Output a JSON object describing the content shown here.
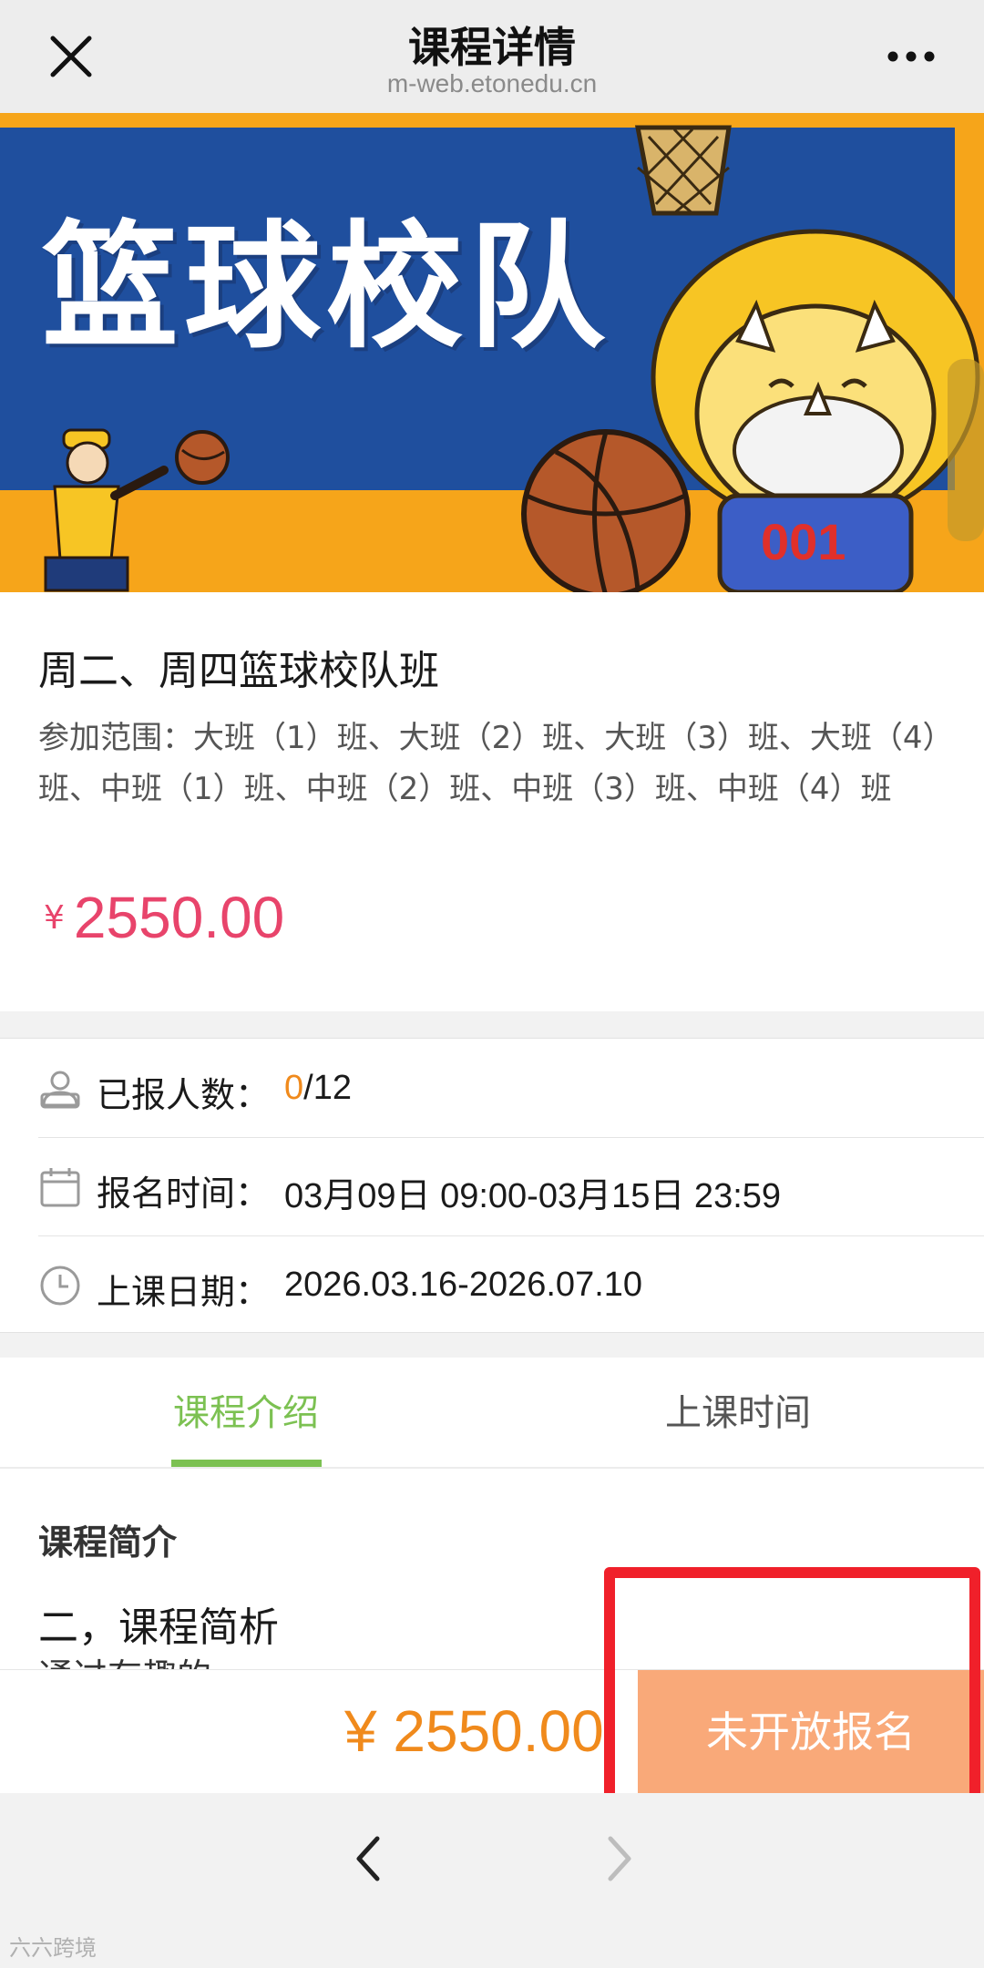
{
  "header": {
    "title": "课程详情",
    "domain": "m-web.etonedu.cn"
  },
  "banner": {
    "title": "篮球校队",
    "jersey_number": "001"
  },
  "course": {
    "name": "周二、周四篮球校队班",
    "scope": "参加范围：大班（1）班、大班（2）班、大班（3）班、大班（4）班、中班（1）班、中班（2）班、中班（3）班、中班（4）班",
    "currency": "¥",
    "price": "2550.00"
  },
  "stats": {
    "enrolled_label": "已报人数：",
    "enrolled_count": "0",
    "enrolled_capacity": "/12",
    "signup_time_label": "报名时间：",
    "signup_time_value": "03月09日 09:00-03月15日 23:59",
    "class_date_label": "上课日期：",
    "class_date_value": "2026.03.16-2026.07.10"
  },
  "tabs": [
    {
      "label": "课程介绍",
      "active": true
    },
    {
      "label": "上课时间",
      "active": false
    }
  ],
  "content": {
    "intro_title": "课程简介",
    "section_title": "二，课程简析",
    "section_text": "通过有趣的…"
  },
  "action_bar": {
    "price": "¥ 2550.00",
    "signup_label": "未开放报名"
  },
  "watermark": "六六跨境",
  "colors": {
    "accent_green": "#7cc152",
    "price_pink": "#e8446b",
    "price_orange": "#f08a1c",
    "signup_button": "#f9a979",
    "highlight_red": "#f0202a",
    "banner_blue": "#1f4f9e",
    "banner_gold": "#f6a51a"
  },
  "icons": {
    "close": "close-icon",
    "more": "more-icon",
    "enrolled": "person-icon",
    "signup_time": "calendar-icon",
    "class_date": "clock-icon",
    "back": "chevron-left-icon",
    "forward": "chevron-right-icon"
  }
}
